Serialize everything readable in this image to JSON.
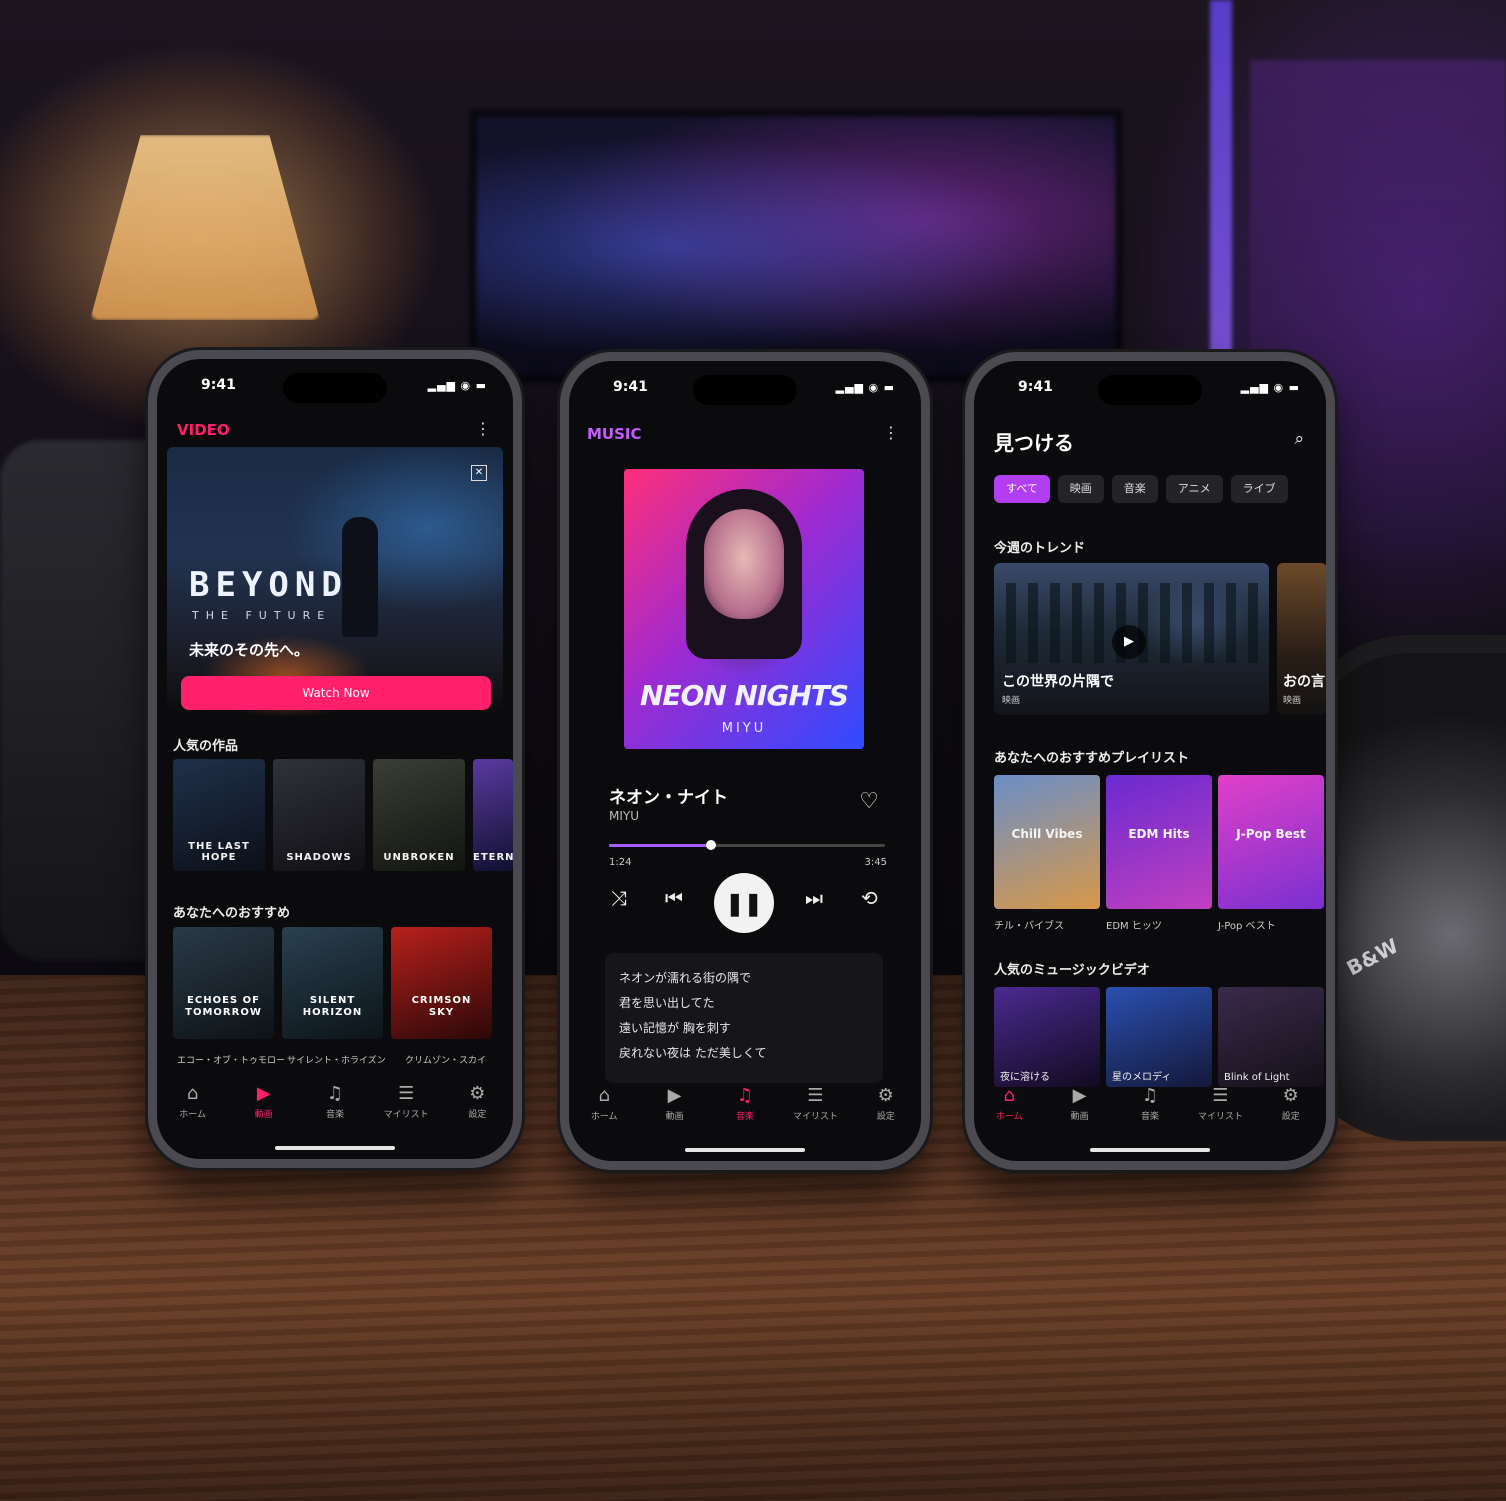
{
  "status": {
    "time": "9:41",
    "icons": "▂▄▆ ◉ ▬"
  },
  "tabs": [
    {
      "label": "ホーム",
      "icon": "⌂"
    },
    {
      "label": "動画",
      "icon": "▶"
    },
    {
      "label": "音楽",
      "icon": "♫"
    },
    {
      "label": "マイリスト",
      "icon": "☰"
    },
    {
      "label": "設定",
      "icon": "⚙"
    }
  ],
  "video": {
    "brand": "VIDEO",
    "hero": {
      "title": "BEYOND",
      "subtitle": "THE FUTURE",
      "tagline": "未来のその先へ。",
      "button": "Watch Now"
    },
    "popular_title": "人気の作品",
    "popular": [
      {
        "title": "THE LAST HOPE",
        "color1": "#20304a",
        "color2": "#0b1018"
      },
      {
        "title": "SHADOWS",
        "color1": "#30323a",
        "color2": "#101014"
      },
      {
        "title": "UNBROKEN",
        "color1": "#3a3e34",
        "color2": "#121410"
      },
      {
        "title": "ETERN",
        "color1": "#5a3aa0",
        "color2": "#101030"
      }
    ],
    "recommend_title": "あなたへのおすすめ",
    "recommend": [
      {
        "title": "ECHOES OF\nTOMORROW",
        "caption": "エコー・オブ・トゥモロー",
        "color1": "#2a3a48",
        "color2": "#0d1216"
      },
      {
        "title": "SILENT\nHORIZON",
        "caption": "サイレント・ホライズン",
        "color1": "#2a4050",
        "color2": "#0c1418"
      },
      {
        "title": "CRIMSON\nSKY",
        "caption": "クリムゾン・スカイ",
        "color1": "#b8201c",
        "color2": "#2a0808"
      }
    ]
  },
  "music": {
    "brand": "MUSIC",
    "album_title": "NEON NIGHTS",
    "album_artist": "MIYU",
    "song_title": "ネオン・ナイト",
    "song_artist": "MIYU",
    "progress": 0.37,
    "time_now": "1:24",
    "time_end": "3:45",
    "controls": {
      "shuffle": "⤨",
      "prev": "⏮",
      "pause": "❚❚",
      "next": "⏭",
      "repeat": "⟲",
      "like": "♡"
    },
    "lyrics": [
      "ネオンが濡れる街の隅で",
      "君を思い出してた",
      "遠い記憶が 胸を刺す",
      "戻れない夜は ただ美しくて"
    ]
  },
  "discover": {
    "title": "見つける",
    "search_icon": "⌕",
    "chips": [
      "すべて",
      "映画",
      "音楽",
      "アニメ",
      "ライブ"
    ],
    "trend_title": "今週のトレンド",
    "trends": [
      {
        "title": "この世界の片隅で",
        "category": "映画"
      },
      {
        "title": "おの言",
        "category": "映画"
      }
    ],
    "playlist_title": "あなたへのおすすめプレイリスト",
    "playlists": [
      {
        "name": "Chill Vibes",
        "caption": "チル・バイブス",
        "color1": "#6a8ec8",
        "color2": "#d89848"
      },
      {
        "name": "EDM Hits",
        "caption": "EDM ヒッツ",
        "color1": "#6a2ad0",
        "color2": "#c040c0"
      },
      {
        "name": "J-Pop Best",
        "caption": "J-Pop ベスト",
        "color1": "#e040c8",
        "color2": "#7a30d0"
      }
    ],
    "mv_title": "人気のミュージックビデオ",
    "mvs": [
      {
        "caption": "夜に溶ける",
        "color1": "#4a2a90",
        "color2": "#120a20"
      },
      {
        "caption": "星のメロディ",
        "color1": "#2a50b0",
        "color2": "#14183a"
      },
      {
        "caption": "Blink of Light",
        "color1": "#3a2a4a",
        "color2": "#141018"
      }
    ]
  },
  "headphone_logo": "B&W"
}
